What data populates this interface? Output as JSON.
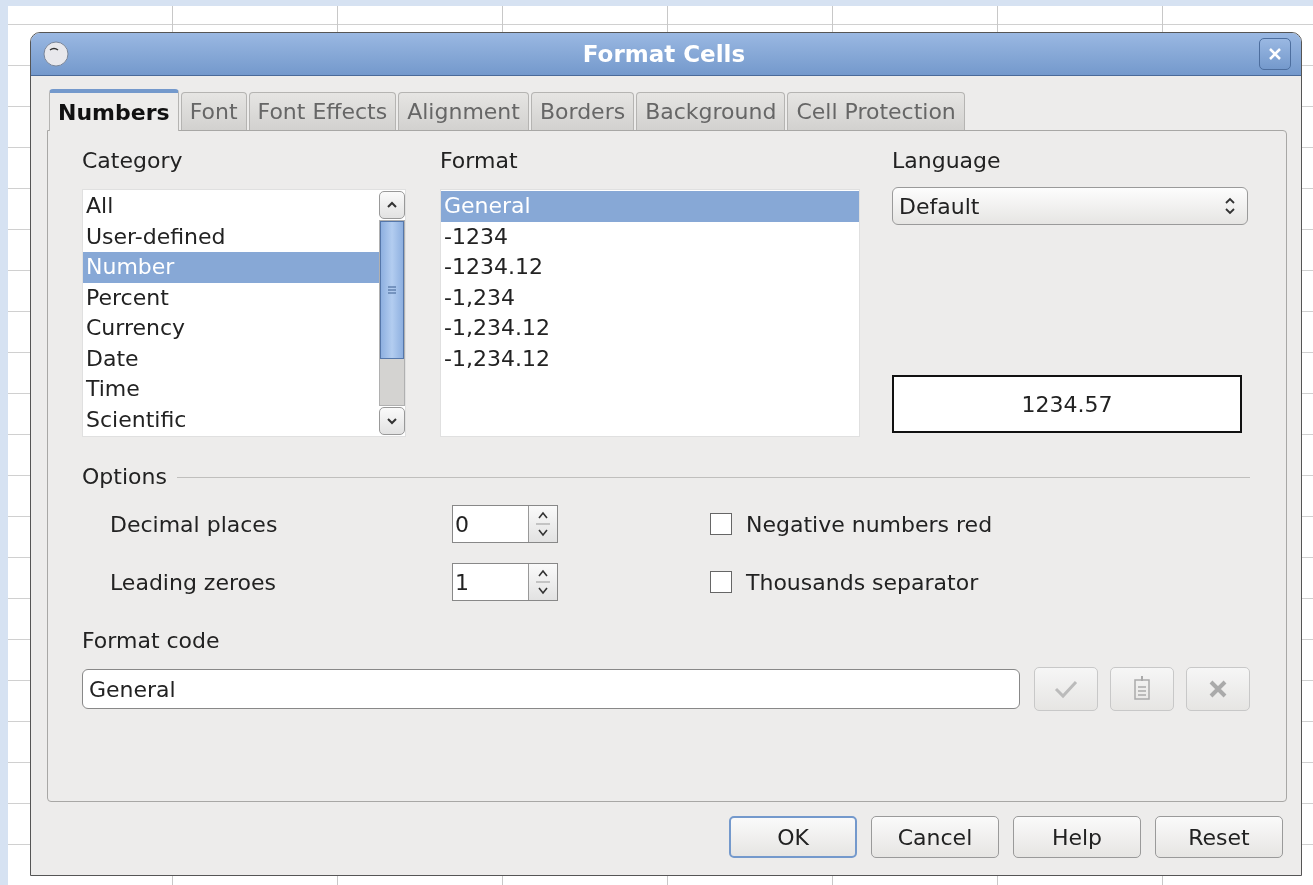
{
  "window": {
    "title": "Format Cells"
  },
  "tabs": [
    {
      "label": "Numbers",
      "selected": true
    },
    {
      "label": "Font",
      "selected": false
    },
    {
      "label": "Font Effects",
      "selected": false
    },
    {
      "label": "Alignment",
      "selected": false
    },
    {
      "label": "Borders",
      "selected": false
    },
    {
      "label": "Background",
      "selected": false
    },
    {
      "label": "Cell Protection",
      "selected": false
    }
  ],
  "category": {
    "label": "Category",
    "items": [
      {
        "label": "All",
        "selected": false
      },
      {
        "label": "User-defined",
        "selected": false
      },
      {
        "label": "Number",
        "selected": true
      },
      {
        "label": "Percent",
        "selected": false
      },
      {
        "label": "Currency",
        "selected": false
      },
      {
        "label": "Date",
        "selected": false
      },
      {
        "label": "Time",
        "selected": false
      },
      {
        "label": "Scientific",
        "selected": false
      }
    ]
  },
  "format": {
    "label": "Format",
    "items": [
      {
        "label": "General",
        "selected": true
      },
      {
        "label": "-1234",
        "selected": false
      },
      {
        "label": "-1234.12",
        "selected": false
      },
      {
        "label": "-1,234",
        "selected": false
      },
      {
        "label": "-1,234.12",
        "selected": false
      },
      {
        "label": "-1,234.12",
        "selected": false
      }
    ]
  },
  "language": {
    "label": "Language",
    "value": "Default"
  },
  "preview": "1234.57",
  "options": {
    "label": "Options",
    "spinners": [
      {
        "label": "Decimal places",
        "value": "0"
      },
      {
        "label": "Leading zeroes",
        "value": "1"
      }
    ],
    "checkboxes": [
      {
        "label": "Negative numbers red",
        "checked": false
      },
      {
        "label": "Thousands separator",
        "checked": false
      }
    ]
  },
  "format_code": {
    "label": "Format code",
    "value": "General"
  },
  "buttons": [
    "OK",
    "Cancel",
    "Help",
    "Reset"
  ]
}
